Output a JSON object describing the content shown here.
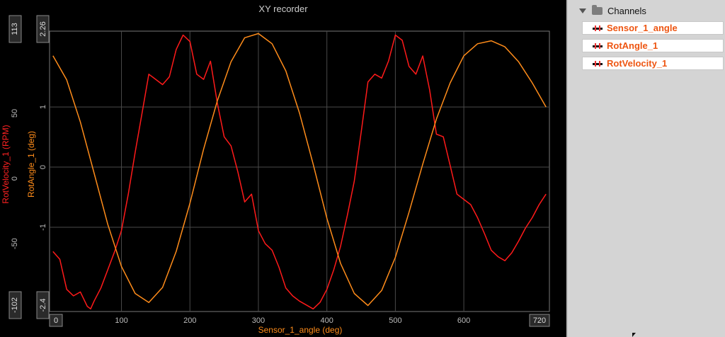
{
  "chart_data": {
    "type": "line",
    "title": "XY recorder",
    "xlabel": "Sensor_1_angle (deg)",
    "xlim": [
      -5,
      725
    ],
    "x_ticks": [
      100,
      200,
      300,
      400,
      500,
      600
    ],
    "x_min_label": "0",
    "x_max_label": "720",
    "grid": true,
    "y_axes": [
      {
        "label": "RotVelocity_1 (RPM)",
        "color": "#ff2222",
        "ylim": [
          -102,
          113
        ],
        "ticks": [
          50,
          0,
          -50
        ],
        "min_label": "-102",
        "max_label": "113"
      },
      {
        "label": "RotAngle_1 (deg)",
        "color": "#ff8c1a",
        "ylim": [
          -2.4,
          2.26
        ],
        "ticks": [
          1,
          0,
          -1
        ],
        "min_label": "-2.4",
        "max_label": "2.26"
      }
    ],
    "series": [
      {
        "name": "RotVelocity_1",
        "axis": 0,
        "color": "#ff1a1a",
        "x": [
          0,
          10,
          20,
          30,
          40,
          50,
          55,
          60,
          70,
          80,
          90,
          100,
          110,
          120,
          130,
          140,
          150,
          160,
          170,
          180,
          190,
          200,
          210,
          220,
          230,
          240,
          250,
          260,
          270,
          280,
          290,
          300,
          310,
          320,
          330,
          340,
          350,
          360,
          370,
          380,
          390,
          400,
          410,
          420,
          430,
          440,
          450,
          460,
          470,
          480,
          490,
          500,
          510,
          520,
          530,
          540,
          550,
          560,
          570,
          580,
          590,
          600,
          610,
          620,
          630,
          640,
          650,
          660,
          670,
          680,
          690,
          700,
          710,
          720
        ],
        "values": [
          -56,
          -62,
          -85,
          -90,
          -87,
          -98,
          -100,
          -94,
          -84,
          -70,
          -56,
          -40,
          -12,
          20,
          50,
          80,
          76,
          72,
          78,
          99,
          110,
          105,
          80,
          76,
          90,
          58,
          32,
          25,
          5,
          -18,
          -12,
          -40,
          -50,
          -55,
          -68,
          -84,
          -90,
          -94,
          -97,
          -100,
          -95,
          -85,
          -70,
          -52,
          -28,
          -2,
          35,
          74,
          80,
          77,
          90,
          110,
          106,
          86,
          80,
          94,
          68,
          34,
          32,
          10,
          -12,
          -16,
          -20,
          -30,
          -42,
          -55,
          -60,
          -63,
          -57,
          -48,
          -38,
          -30,
          -20,
          -12
        ]
      },
      {
        "name": "RotAngle_1",
        "axis": 1,
        "color": "#ff8c1a",
        "x": [
          0,
          20,
          40,
          60,
          80,
          100,
          120,
          140,
          160,
          180,
          200,
          220,
          240,
          260,
          280,
          300,
          320,
          340,
          360,
          380,
          400,
          420,
          440,
          460,
          480,
          500,
          520,
          540,
          560,
          580,
          600,
          620,
          640,
          660,
          680,
          700,
          720
        ],
        "values": [
          1.85,
          1.45,
          0.75,
          -0.1,
          -0.95,
          -1.65,
          -2.1,
          -2.25,
          -2.0,
          -1.4,
          -0.6,
          0.3,
          1.1,
          1.75,
          2.15,
          2.22,
          2.05,
          1.6,
          0.9,
          0.05,
          -0.85,
          -1.6,
          -2.1,
          -2.3,
          -2.05,
          -1.5,
          -0.75,
          0.05,
          0.8,
          1.4,
          1.85,
          2.05,
          2.1,
          2.0,
          1.75,
          1.4,
          1.0
        ]
      }
    ]
  },
  "channels_panel": {
    "header": "Channels",
    "items": [
      "Sensor_1_angle",
      "RotAngle_1",
      "RotVelocity_1"
    ]
  }
}
